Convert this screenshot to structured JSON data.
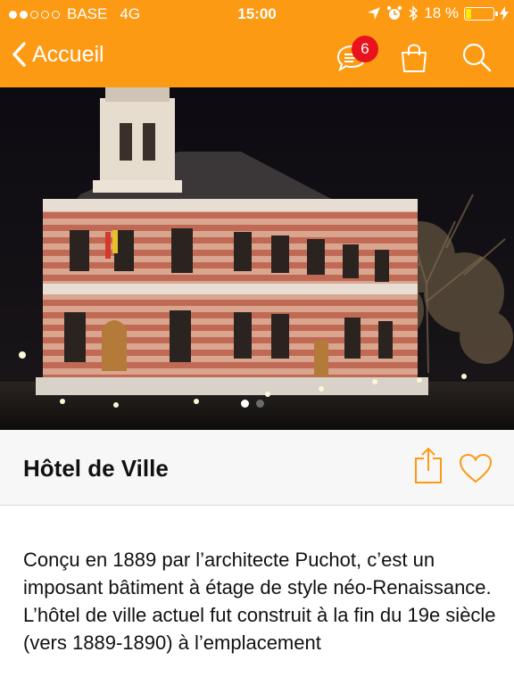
{
  "status": {
    "carrier": "BASE",
    "network": "4G",
    "time": "15:00",
    "battery": "18 %"
  },
  "nav": {
    "back_label": "Accueil",
    "badge_count": "6"
  },
  "place": {
    "title": "Hôtel de Ville",
    "paragraphs": [
      "Conçu en 1889 par l’architecte Puchot, c’est un imposant bâtiment à étage de style néo-Renaissance.",
      "L’hôtel de ville actuel fut construit à la fin du 19e siècle (vers 1889-1890) à l’emplacement"
    ]
  },
  "colors": {
    "accent": "#fc9a14",
    "badge": "#e8131c"
  },
  "icons": [
    "chevron-left-icon",
    "chat-icon",
    "shopping-bag-icon",
    "search-icon",
    "share-icon",
    "heart-icon"
  ]
}
